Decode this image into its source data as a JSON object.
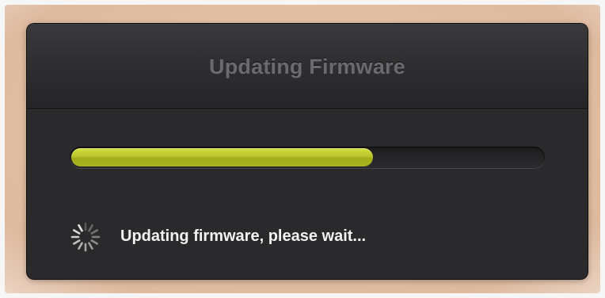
{
  "dialog": {
    "title": "Updating Firmware",
    "progress": {
      "value": 0.64,
      "fill_color": "#b5c026"
    },
    "spinner_icon": "activity-spinner-icon",
    "status": "Updating firmware, please wait..."
  },
  "colors": {
    "dialog_background": "#2a2a2c",
    "title_text": "#6b6b6f",
    "status_text": "#f2f2f2",
    "backdrop": "#e2bfa3"
  }
}
